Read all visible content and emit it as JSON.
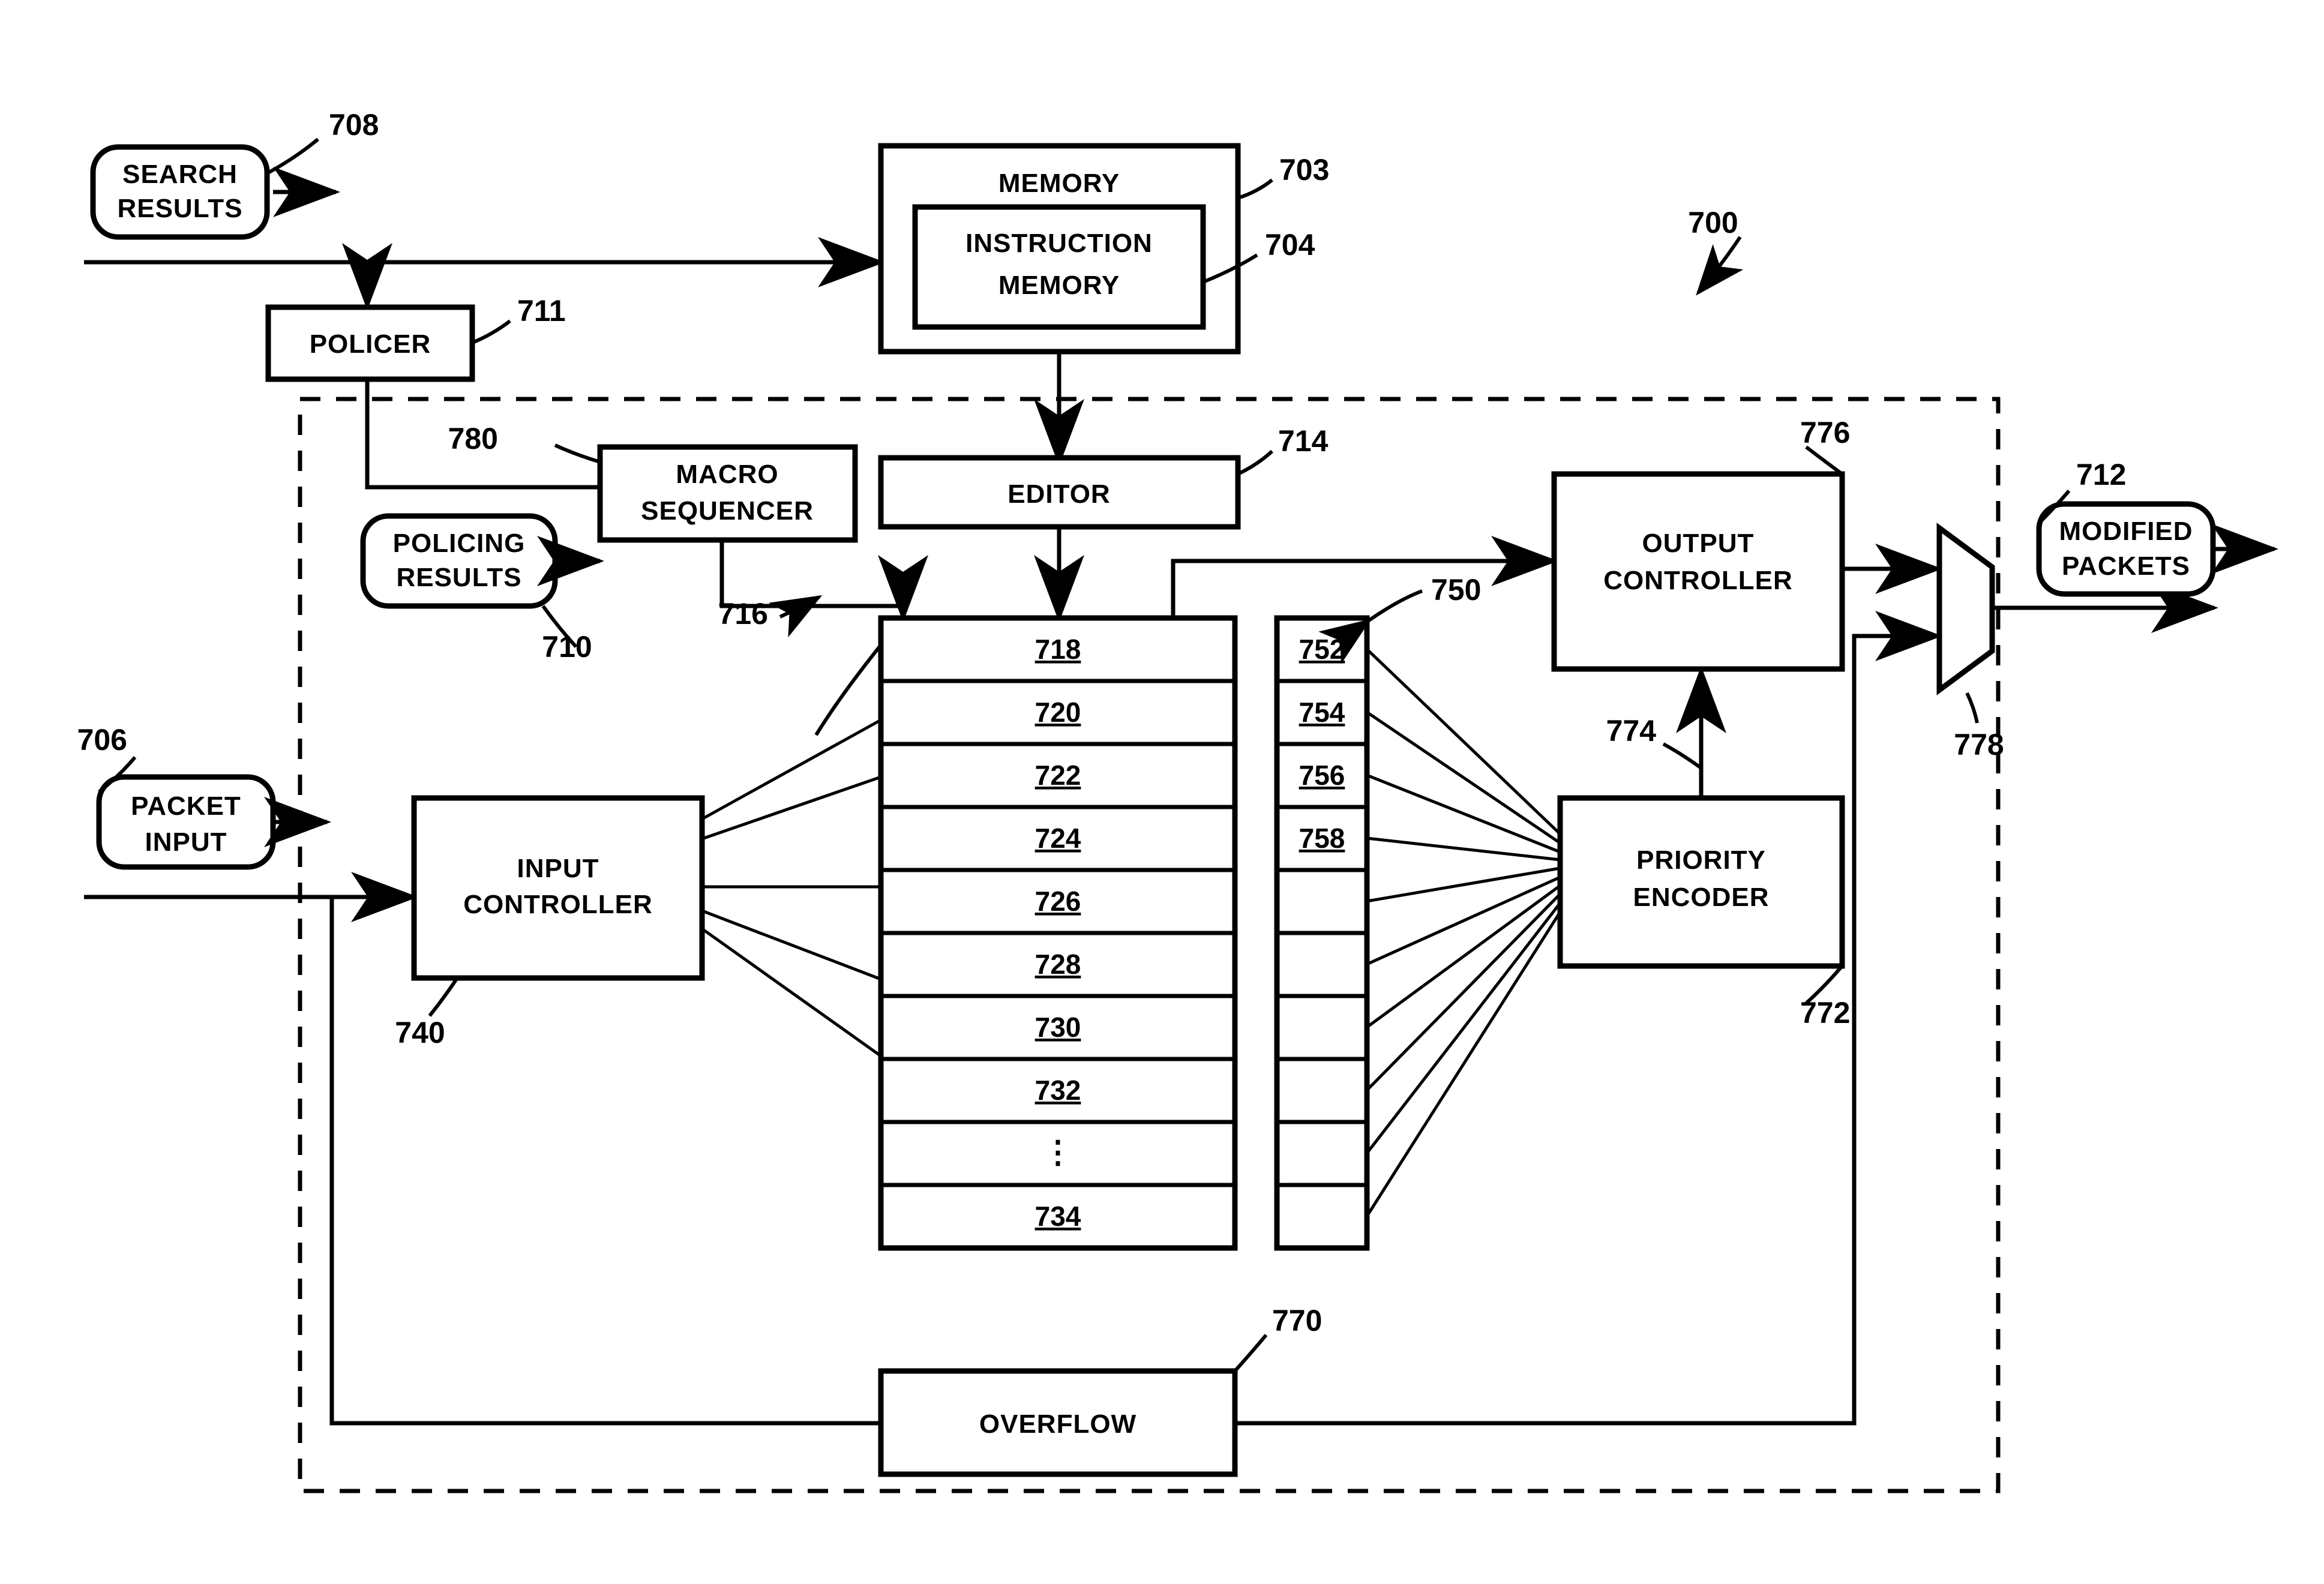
{
  "figure": {
    "id": "700",
    "type": "patent-block-diagram",
    "line_color": "#000000",
    "background": "#ffffff"
  },
  "blocks": {
    "search_results": {
      "label_line1": "SEARCH",
      "label_line2": "RESULTS",
      "ref": "708",
      "shape": "rounded"
    },
    "policer": {
      "label": "POLICER",
      "ref": "711",
      "shape": "rect"
    },
    "memory": {
      "label": "MEMORY",
      "ref": "703",
      "shape": "rect"
    },
    "instruction_memory": {
      "label_line1": "INSTRUCTION",
      "label_line2": "MEMORY",
      "ref": "704",
      "shape": "rect"
    },
    "macro_sequencer": {
      "label_line1": "MACRO",
      "label_line2": "SEQUENCER",
      "ref": "780",
      "shape": "rect"
    },
    "policing_results": {
      "label_line1": "POLICING",
      "label_line2": "RESULTS",
      "ref": "710",
      "shape": "rounded"
    },
    "editor": {
      "label": "EDITOR",
      "ref": "714",
      "shape": "rect"
    },
    "packet_input": {
      "label_line1": "PACKET",
      "label_line2": "INPUT",
      "ref": "706",
      "shape": "rounded"
    },
    "input_controller": {
      "label_line1": "INPUT",
      "label_line2": "CONTROLLER",
      "ref": "740",
      "shape": "rect"
    },
    "output_controller": {
      "label_line1": "OUTPUT",
      "label_line2": "CONTROLLER",
      "ref": "776",
      "shape": "rect"
    },
    "priority_encoder": {
      "label_line1": "PRIORITY",
      "label_line2": "ENCODER",
      "ref": "772",
      "shape": "rect"
    },
    "overflow": {
      "label": "OVERFLOW",
      "ref": "770",
      "shape": "rect"
    },
    "multiplexer": {
      "ref": "778",
      "shape": "trapezoid"
    },
    "modified_packets": {
      "label_line1": "MODIFIED",
      "label_line2": "PACKETS",
      "ref": "712",
      "shape": "rounded"
    }
  },
  "buffer_stack": {
    "ref": "716",
    "cells": [
      "718",
      "720",
      "722",
      "724",
      "726",
      "728",
      "730",
      "732",
      "⋮",
      "734"
    ]
  },
  "flag_column": {
    "ref": "750",
    "cells": [
      "752",
      "754",
      "756",
      "758",
      "",
      "",
      "",
      "",
      "",
      ""
    ]
  },
  "reference_numerals": {
    "figure": "700",
    "memory": "703",
    "instruction_memory": "704",
    "packet_input": "706",
    "search_results": "708",
    "policing_results": "710",
    "policer": "711",
    "modified_packets": "712",
    "editor": "714",
    "buffer_stack": "716",
    "input_controller": "740",
    "flag_column": "750",
    "overflow": "770",
    "priority_encoder": "772",
    "encoder_output": "774",
    "output_controller": "776",
    "multiplexer": "778",
    "macro_sequencer": "780"
  }
}
